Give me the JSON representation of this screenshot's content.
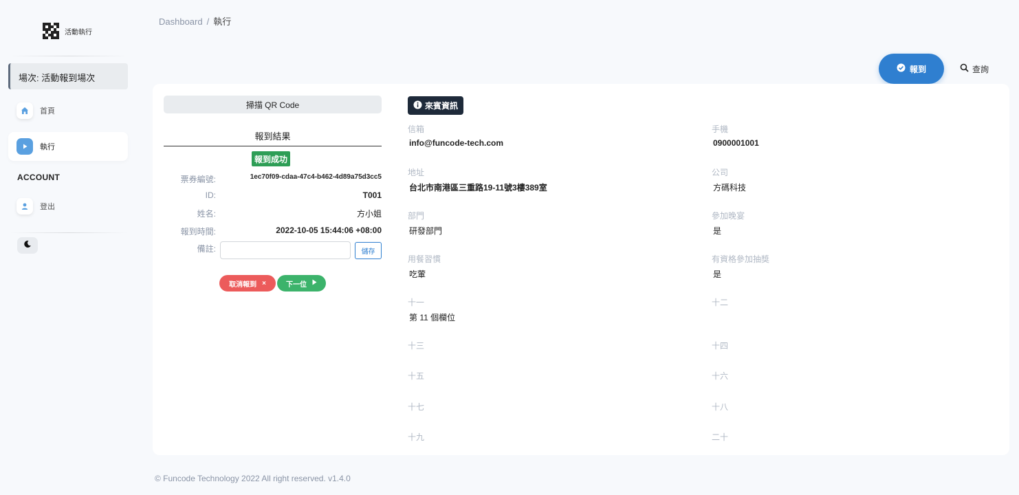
{
  "sidebar": {
    "brand_name": "活動執行",
    "session_label": "場次: 活動報到場次",
    "items": [
      {
        "label": "首頁",
        "icon": "home-icon"
      },
      {
        "label": "執行",
        "icon": "play-icon"
      }
    ],
    "account_heading": "ACCOUNT",
    "logout_label": "登出"
  },
  "header": {
    "breadcrumb_root": "Dashboard",
    "breadcrumb_sep": "/",
    "breadcrumb_current": "執行",
    "checkin_label": "報到",
    "query_label": "查詢"
  },
  "scan": {
    "title": "掃描 QR Code",
    "result_title": "報到結果",
    "status": "報到成功",
    "rows": [
      {
        "label": "票券編號:",
        "value": "1ec70f09-cdaa-47c4-b462-4d89a75d3cc5"
      },
      {
        "label": "ID:",
        "value": "T001"
      },
      {
        "label": "姓名:",
        "value": "方小姐"
      },
      {
        "label": "報到時間:",
        "value": "2022-10-05 15:44:06 +08:00"
      }
    ],
    "note_label": "備註:",
    "note_value": "",
    "save_label": "儲存",
    "cancel_label": "取消報到",
    "cancel_mark": "×",
    "next_label": "下一位"
  },
  "guest": {
    "badge_label": "來賓資訊",
    "fields": [
      {
        "label": "信箱",
        "value": "info@funcode-tech.com"
      },
      {
        "label": "手機",
        "value": "0900001001"
      },
      {
        "label": "地址",
        "value": "台北市南港區三重路19-11號3樓389室"
      },
      {
        "label": "公司",
        "value": "方碼科技"
      },
      {
        "label": "部門",
        "value": "研發部門"
      },
      {
        "label": "參加晚宴",
        "value": "是"
      },
      {
        "label": "用餐習慣",
        "value": "吃葷"
      },
      {
        "label": "有資格參加抽獎",
        "value": "是"
      },
      {
        "label": "十一",
        "value": "第 11 個欄位"
      },
      {
        "label": "十二",
        "value": ""
      },
      {
        "label": "十三",
        "value": ""
      },
      {
        "label": "十四",
        "value": ""
      },
      {
        "label": "十五",
        "value": ""
      },
      {
        "label": "十六",
        "value": ""
      },
      {
        "label": "十七",
        "value": ""
      },
      {
        "label": "十八",
        "value": ""
      },
      {
        "label": "十九",
        "value": ""
      },
      {
        "label": "二十",
        "value": ""
      }
    ]
  },
  "footer": {
    "text": "© Funcode Technology 2022 All right reserved. v1.4.0"
  },
  "colors": {
    "primary": "#2f7fd0",
    "success": "#2e9e56",
    "danger": "#ec5b5b",
    "next": "#3cb36b",
    "badge": "#1e2a3a"
  }
}
